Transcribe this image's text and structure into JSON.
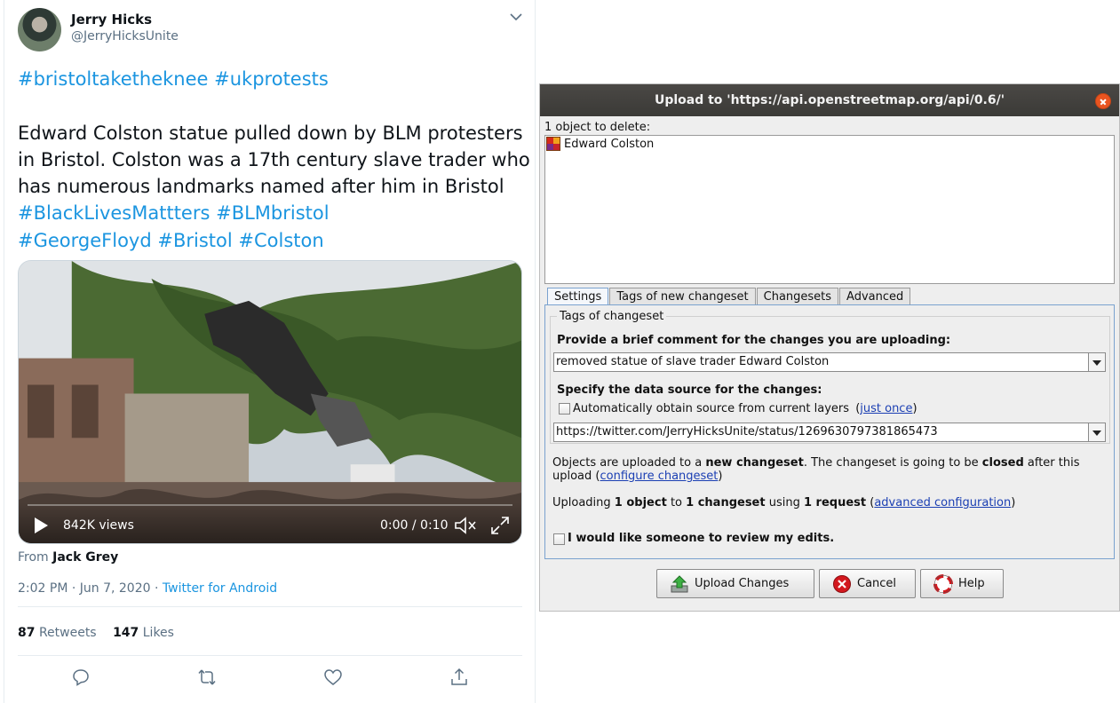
{
  "tweet": {
    "author_name": "Jerry Hicks",
    "author_handle": "@JerryHicksUnite",
    "hashtags_top": [
      "#bristoltaketheknee",
      "#ukprotests"
    ],
    "body_lines": [
      "Edward Colston statue pulled down by BLM protesters",
      "in Bristol. Colston was a 17th century slave trader who",
      "has numerous landmarks named after him in Bristol"
    ],
    "hashtags_line1": [
      "#BlackLivesMattters",
      "#BLMbristol"
    ],
    "hashtags_line2": [
      "#GeorgeFloyd",
      "#Bristol",
      "#Colston"
    ],
    "video": {
      "views": "842K views",
      "time": "0:00 / 0:10"
    },
    "from_label": "From",
    "from_name": "Jack Grey",
    "timestamp": "2:02 PM · Jun 7, 2020",
    "separator": "·",
    "source": "Twitter for Android",
    "retweets_count": "87",
    "retweets_label": "Retweets",
    "likes_count": "147",
    "likes_label": "Likes",
    "icons": [
      "chevron-down-icon",
      "play-icon",
      "mute-icon",
      "fullscreen-icon",
      "reply-icon",
      "retweet-icon",
      "like-icon",
      "share-icon"
    ]
  },
  "dialog": {
    "title": "Upload to 'https://api.openstreetmap.org/api/0.6/'",
    "delete_label": "1 object to delete:",
    "delete_items": [
      "Edward Colston"
    ],
    "tabs": [
      {
        "label": "Settings",
        "active": true
      },
      {
        "label": "Tags of new changeset",
        "active": false
      },
      {
        "label": "Changesets",
        "active": false
      },
      {
        "label": "Advanced",
        "active": false
      }
    ],
    "group_title": "Tags of changeset",
    "comment_label": "Provide a brief comment for the changes you are uploading:",
    "comment_value": "removed statue of slave trader Edward Colston",
    "source_label": "Specify the data source for the changes:",
    "auto_source_label": "Automatically obtain source from current layers",
    "auto_source_open": "(",
    "auto_source_link": "just once",
    "auto_source_close": ")",
    "source_value": "https://twitter.com/JerryHicksUnite/status/1269630797381865473",
    "info1": {
      "t1": "Objects are uploaded to a ",
      "b1": "new changeset",
      "t2": ". The changeset is going to be ",
      "b2": "closed",
      "t3": " after this",
      "t4": "upload (",
      "link": "configure changeset",
      "t5": ")"
    },
    "info2": {
      "t1": "Uploading ",
      "b1": "1 object",
      "t2": " to ",
      "b2": "1 changeset",
      "t3": " using ",
      "b3": "1 request",
      "t4": " (",
      "link": "advanced configuration",
      "t5": ")"
    },
    "review_label": "I would like someone to review my edits.",
    "buttons": {
      "upload": "Upload Changes",
      "cancel": "Cancel",
      "help": "Help"
    },
    "colors": {
      "titlebar": "#3b3a37",
      "close": "#e95420",
      "link": "#1b3fb3",
      "tab_active_border": "#7aa2cf"
    }
  }
}
